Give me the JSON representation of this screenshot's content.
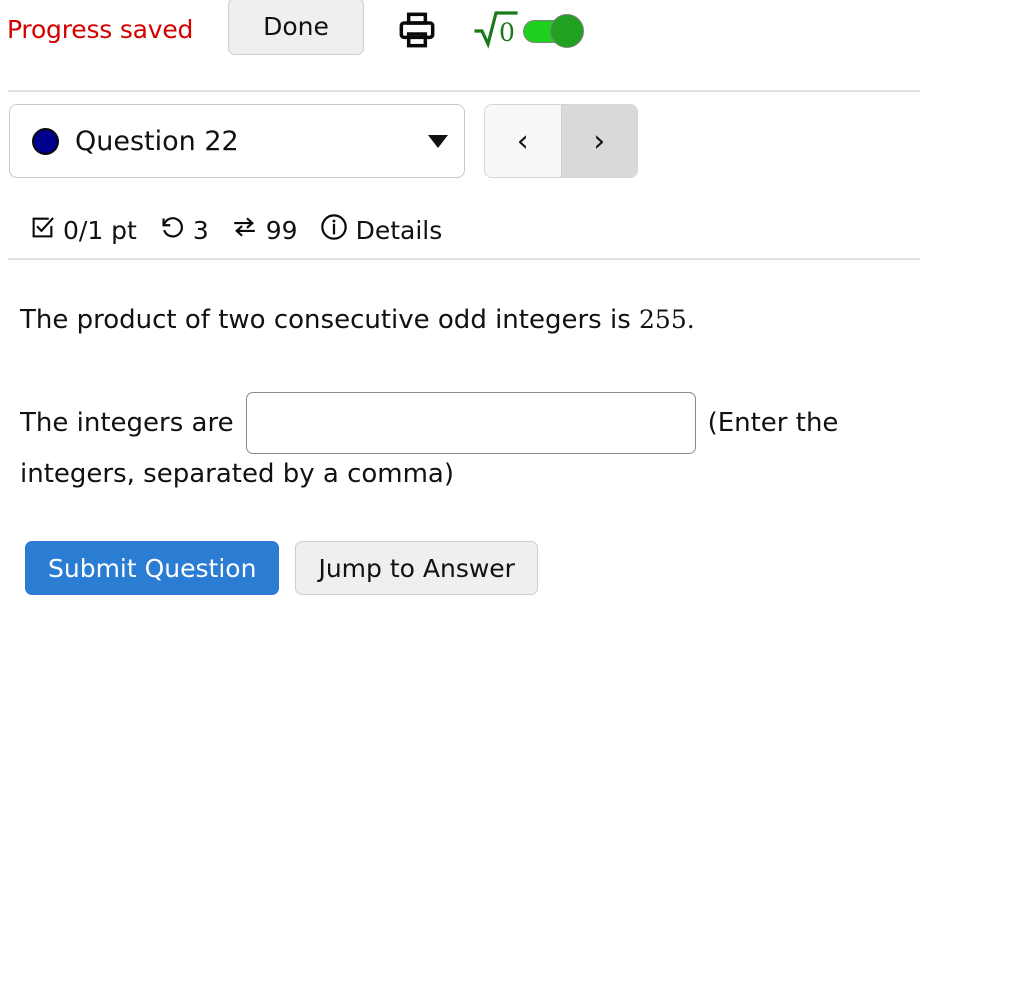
{
  "toolbar": {
    "progress_status": "Progress saved",
    "progress_status_color": "#d40000",
    "done_label": "Done",
    "print_icon": "printer-icon",
    "calculator_icon": "square-root-icon",
    "calculator_toggle_state": "on",
    "toggle_on_color": "#1fd11f",
    "toggle_knob_color": "#22a022",
    "sqrt_color": "#1a7a1a"
  },
  "question_nav": {
    "status_dot_color": "#00008f",
    "selected_question": "Question 22",
    "dropdown_icon": "chevron-down-icon",
    "prev_label": "‹",
    "next_label": "›"
  },
  "status_bar": {
    "score_icon": "check-square-icon",
    "score": "0/1 pt",
    "attempts_icon": "undo-icon",
    "attempts": "3",
    "versions_icon": "exchange-icon",
    "versions": "99",
    "info_icon": "info-circle-icon",
    "details_label": "Details"
  },
  "question": {
    "prompt_prefix": "The product of two consecutive odd integers is ",
    "prompt_value": "255.",
    "answer_lead": "The integers are",
    "answer_value": "",
    "answer_placeholder": "",
    "hint_head": "(Enter the",
    "hint_tail": "integers, separated by a comma)"
  },
  "actions": {
    "submit_label": "Submit Question",
    "submit_color": "#2b7cd3",
    "jump_label": "Jump to Answer"
  }
}
